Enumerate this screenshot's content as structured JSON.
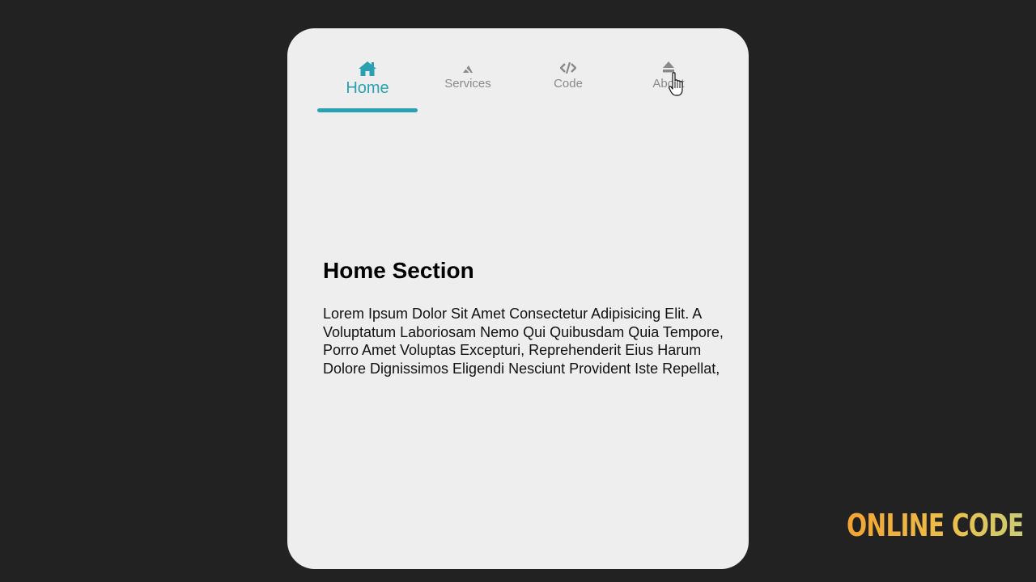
{
  "colors": {
    "accent": "#2aa1b3",
    "background": "#222222",
    "card": "#eeeeee",
    "inactive_tab": "#8a8a8a"
  },
  "nav": {
    "tabs": [
      {
        "label": "Home",
        "icon": "home-icon",
        "active": true
      },
      {
        "label": "Services",
        "icon": "services-icon",
        "active": false
      },
      {
        "label": "Code",
        "icon": "code-icon",
        "active": false
      },
      {
        "label": "About",
        "icon": "eject-icon",
        "active": false
      }
    ]
  },
  "section": {
    "title": "Home Section",
    "text": "Lorem Ipsum Dolor Sit Amet Consectetur Adipisicing Elit. A Voluptatum Laboriosam Nemo Qui Quibusdam Quia Tempore, Porro Amet Voluptas Excepturi, Reprehenderit Eius Harum Dolore Dignissimos Eligendi Nesciunt Provident Iste Repellat,"
  },
  "watermark": "ONLINE CODE"
}
